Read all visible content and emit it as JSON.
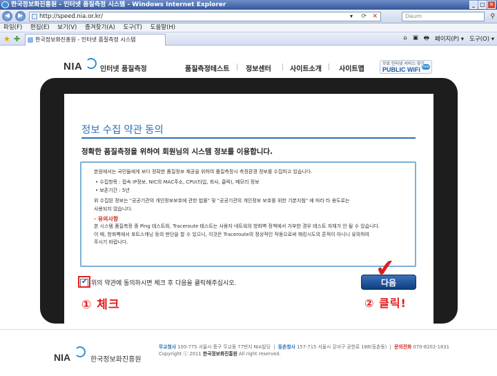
{
  "window": {
    "title": "한국정보화진흥원 - 인터넷 품질측정 시스템 - Windows Internet Explorer",
    "minimize": "_",
    "maximize": "□",
    "close": "✕"
  },
  "browser": {
    "back": "◀",
    "forward": "▶",
    "address": "http://speed.nia.or.kr/",
    "search_placeholder": "Daum",
    "menu": [
      "파일(F)",
      "편집(E)",
      "보기(V)",
      "즐겨찾기(A)",
      "도구(T)",
      "도움말(H)"
    ],
    "tab_title": "한국정보화진흥원 - 인터넷 품질측정 시스템",
    "tools": [
      "⌂",
      "▣",
      "🖶",
      "페이지(P) ▾",
      "도구(O) ▾"
    ]
  },
  "site": {
    "logo": "NIA",
    "logo_sub": "인터넷 품질측정",
    "nav": [
      "품질측정테스트",
      "정보센터",
      "사이트소개",
      "사이트맵"
    ],
    "wifi_line1": "무료 인터넷 서비스 찾기",
    "wifi_line2": "PUBLIC WiFi",
    "wifi_badge": "free"
  },
  "content": {
    "title": "정보 수집 약관 동의",
    "subtitle": "정확한 품질측정을 위하여 회원님의 시스템 정보를 이용합니다.",
    "terms": {
      "intro": "본원에서는 국민들에게 보다 정확한 품질정보 제공을 위하여 품질측정시 측정환경 정보를 수집하고 있습니다.",
      "item1": "• 수집항목 : 접속 IP정보, NIC의 MAC주소, CPU(타입, 회사, 클럭), 메모리 정보",
      "item2": "• 보존기간 : 5년",
      "law1": "위 수집된 정보는 \"공공기관의 개인정보보호에 관한 법률\" 및 \"공공기관의 개인정보 보호를 위한 기본지침\" 에 따라 타 용도로는",
      "law2": "사용되지 않습니다.",
      "warn_title": "· 유의사항",
      "warn1": "본 시스템 품질측정 중 Ping 테스트와, Traceroute 테스트는 사용자 네트웍의 방화벽 정책에서 거부한 경우 테스트 자체가 안 될 수 있습니다.",
      "warn2": "이 때, 방화벽에서 포트스캐닝 등의 판단을 할 수 있으니, 이것은 Traceroute의 정상적인 작동으로써 해킹시도의 흔적이 아니니 유의하여",
      "warn3": "주시기 바랍니다."
    },
    "agree_text": "위의 약관에 동의하시면 체크 후 다음을 클릭해주십시오.",
    "next_button": "다음",
    "annotation_check": "① 체크",
    "annotation_click": "② 클릭!"
  },
  "footer": {
    "logo": "NIA",
    "org_name": "한국정보화진흥원",
    "hq_label": "무교청사",
    "hq_addr": "100-775 서울시 중구 무교동 77번지 NIA빌딩",
    "sep": "|",
    "dg_label": "등촌청사",
    "dg_addr": "157-715 서울시 강서구 공항로 188(등촌동)",
    "tel_label": "문의전화",
    "tel": "070-8202-1631",
    "copyright": "Copyright ⓒ 2011",
    "copyright_org": "한국정보화진흥원",
    "copyright_tail": "All right reserved."
  }
}
